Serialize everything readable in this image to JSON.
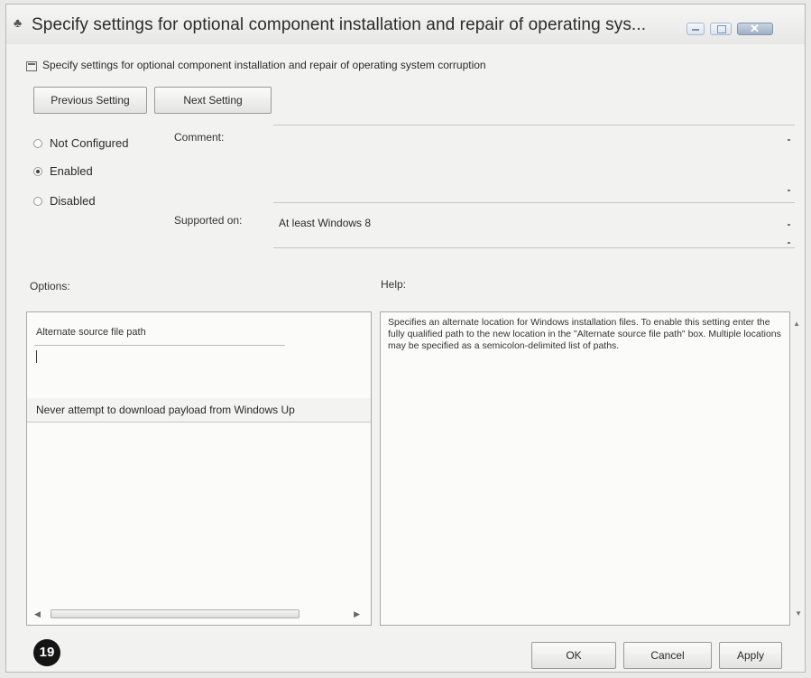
{
  "window": {
    "title": "Specify settings for optional component installation and repair of operating sys...",
    "subtitle": "Specify settings for optional component installation and repair of operating system corruption"
  },
  "nav": {
    "previous_label": "Previous Setting",
    "next_label": "Next Setting"
  },
  "state": {
    "options": [
      {
        "label": "Not Configured",
        "checked": false
      },
      {
        "label": "Enabled",
        "checked": true
      },
      {
        "label": "Disabled",
        "checked": false
      }
    ]
  },
  "fields": {
    "comment_label": "Comment:",
    "comment_value": "",
    "supported_label": "Supported on:",
    "supported_value": "At least Windows 8"
  },
  "options_section": {
    "heading": "Options:",
    "alt_path_label": "Alternate source file path",
    "alt_path_value": "",
    "never_download_label": "Never attempt to download payload from Windows Up"
  },
  "help_section": {
    "heading": "Help:",
    "text": "Specifies an alternate location for Windows installation files. To enable this setting enter the fully qualified path to the new location in the \"Alternate source file path\" box. Multiple locations may be specified as a semicolon-delimited list of paths."
  },
  "footer": {
    "step_badge": "19",
    "ok_label": "OK",
    "cancel_label": "Cancel",
    "apply_label": "Apply"
  },
  "colors": {
    "window_bg": "#f2f2f0",
    "panel_bg": "#fbfbfa",
    "close_button": "#9fb0c4"
  },
  "icons": [
    "policy-icon",
    "minimize-icon",
    "maximize-icon",
    "close-icon",
    "setting-icon",
    "scroll-left-icon",
    "scroll-right-icon",
    "scroll-up-icon",
    "scroll-down-icon"
  ]
}
